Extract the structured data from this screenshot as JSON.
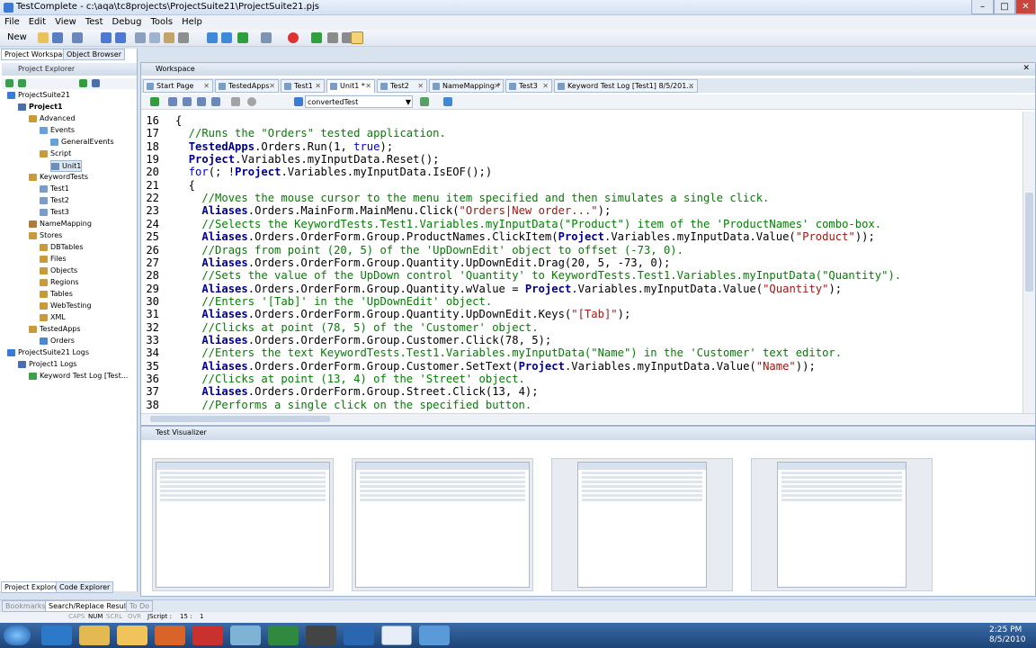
{
  "app_title": "TestComplete - c:\\aqa\\tc8projects\\ProjectSuite21\\ProjectSuite21.pjs",
  "menu": [
    "File",
    "Edit",
    "View",
    "Test",
    "Debug",
    "Tools",
    "Help"
  ],
  "toolbar": {
    "new_label": "New"
  },
  "left_panel": {
    "tabs": [
      "Project Workspace",
      "Object Browser"
    ],
    "header": "Project Explorer",
    "tree": [
      {
        "label": "ProjectSuite21",
        "level": 0
      },
      {
        "label": "Project1",
        "level": 1
      },
      {
        "label": "Advanced",
        "level": 2
      },
      {
        "label": "Events",
        "level": 3
      },
      {
        "label": "GeneralEvents",
        "level": 4
      },
      {
        "label": "Script",
        "level": 3
      },
      {
        "label": "Unit1",
        "level": 4
      },
      {
        "label": "KeywordTests",
        "level": 2
      },
      {
        "label": "Test1",
        "level": 3
      },
      {
        "label": "Test2",
        "level": 3
      },
      {
        "label": "Test3",
        "level": 3
      },
      {
        "label": "NameMapping",
        "level": 2
      },
      {
        "label": "Stores",
        "level": 2
      },
      {
        "label": "DBTables",
        "level": 3
      },
      {
        "label": "Files",
        "level": 3
      },
      {
        "label": "Objects",
        "level": 3
      },
      {
        "label": "Regions",
        "level": 3
      },
      {
        "label": "Tables",
        "level": 3
      },
      {
        "label": "WebTesting",
        "level": 3
      },
      {
        "label": "XML",
        "level": 3
      },
      {
        "label": "TestedApps",
        "level": 2
      },
      {
        "label": "Orders",
        "level": 3
      },
      {
        "label": "ProjectSuite21 Logs",
        "level": 0
      },
      {
        "label": "Project1 Logs",
        "level": 1
      },
      {
        "label": "Keyword Test Log [Test...",
        "level": 2
      }
    ],
    "bottom_tabs": [
      "Project Explorer",
      "Code Explorer"
    ]
  },
  "workspace": {
    "header": "Workspace",
    "tabs": [
      "Start Page",
      "TestedApps",
      "Test1",
      "Unit1 *",
      "Test2",
      "NameMapping *",
      "Test3",
      "Keyword Test Log [Test1] 8/5/201..."
    ],
    "routine_selector": "convertedTest",
    "code_lines": [
      {
        "n": "16",
        "t": "{"
      },
      {
        "n": "17",
        "t": "  //Runs the \"Orders\" tested application."
      },
      {
        "n": "18",
        "t": "  TestedApps.Orders.Run(1, true);"
      },
      {
        "n": "19",
        "t": "  Project.Variables.myInputData.Reset();"
      },
      {
        "n": "20",
        "t": "  for(; !Project.Variables.myInputData.IsEOF();)"
      },
      {
        "n": "21",
        "t": "  {"
      },
      {
        "n": "22",
        "t": "    //Moves the mouse cursor to the menu item specified and then simulates a single click."
      },
      {
        "n": "23",
        "t": "    Aliases.Orders.MainForm.MainMenu.Click(\"Orders|New order...\");"
      },
      {
        "n": "24",
        "t": "    //Selects the KeywordTests.Test1.Variables.myInputData(\"Product\") item of the 'ProductNames' combo-box."
      },
      {
        "n": "25",
        "t": "    Aliases.Orders.OrderForm.Group.ProductNames.ClickItem(Project.Variables.myInputData.Value(\"Product\"));"
      },
      {
        "n": "26",
        "t": "    //Drags from point (20, 5) of the 'UpDownEdit' object to offset (-73, 0)."
      },
      {
        "n": "27",
        "t": "    Aliases.Orders.OrderForm.Group.Quantity.UpDownEdit.Drag(20, 5, -73, 0);"
      },
      {
        "n": "28",
        "t": "    //Sets the value of the UpDown control 'Quantity' to KeywordTests.Test1.Variables.myInputData(\"Quantity\")."
      },
      {
        "n": "29",
        "t": "    Aliases.Orders.OrderForm.Group.Quantity.wValue = Project.Variables.myInputData.Value(\"Quantity\");"
      },
      {
        "n": "30",
        "t": "    //Enters '[Tab]' in the 'UpDownEdit' object."
      },
      {
        "n": "31",
        "t": "    Aliases.Orders.OrderForm.Group.Quantity.UpDownEdit.Keys(\"[Tab]\");"
      },
      {
        "n": "32",
        "t": "    //Clicks at point (78, 5) of the 'Customer' object."
      },
      {
        "n": "33",
        "t": "    Aliases.Orders.OrderForm.Group.Customer.Click(78, 5);"
      },
      {
        "n": "34",
        "t": "    //Enters the text KeywordTests.Test1.Variables.myInputData(\"Name\") in the 'Customer' text editor."
      },
      {
        "n": "35",
        "t": "    Aliases.Orders.OrderForm.Group.Customer.SetText(Project.Variables.myInputData.Value(\"Name\"));"
      },
      {
        "n": "36",
        "t": "    //Clicks at point (13, 4) of the 'Street' object."
      },
      {
        "n": "37",
        "t": "    Aliases.Orders.OrderForm.Group.Street.Click(13, 4);"
      },
      {
        "n": "38",
        "t": "    //Performs a single click on the specified button."
      }
    ]
  },
  "visualizer": {
    "header": "Test Visualizer",
    "frames": [
      "frame1",
      "frame2",
      "frame3",
      "frame4"
    ]
  },
  "bottom_tabs": [
    "Bookmarks",
    "Search/Replace Results",
    "To Do"
  ],
  "status": {
    "caps": "CAPS",
    "num": "NUM",
    "scrl": "SCRL",
    "ovr": "OVR",
    "lang": "JScript :",
    "line": "15 :",
    "col": "1"
  },
  "clock": {
    "time": "2:25 PM",
    "date": "8/5/2010"
  }
}
